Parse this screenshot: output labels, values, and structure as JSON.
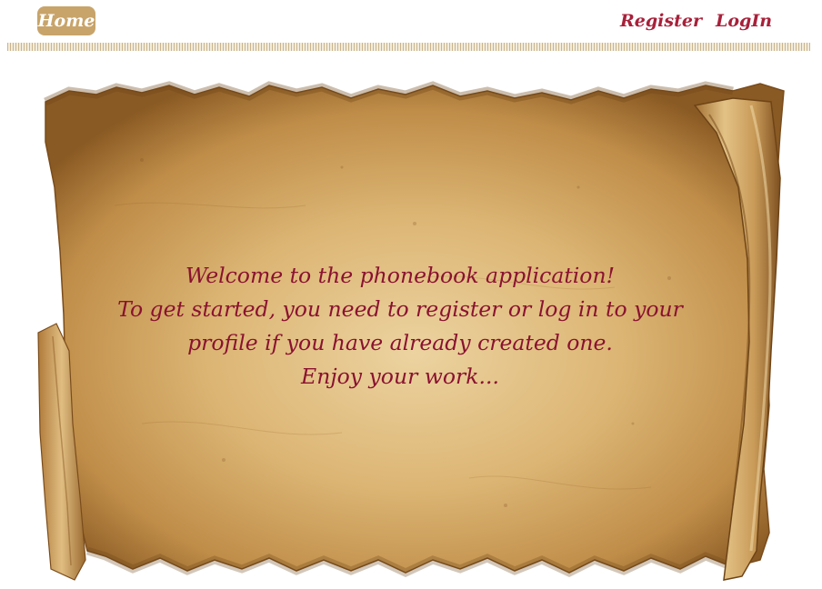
{
  "nav": {
    "home_label": "Home",
    "register_label": "Register",
    "login_label": "LogIn"
  },
  "welcome": {
    "line1": "Welcome to the phonebook application!",
    "line2": "To get started, you need to register or log in to your",
    "line3": "profile if you have already created one.",
    "line4": "Enjoy your work..."
  },
  "colors": {
    "accent": "#a8203a",
    "home_button_bg": "#c8a46a",
    "parchment": "#d9b57a"
  }
}
